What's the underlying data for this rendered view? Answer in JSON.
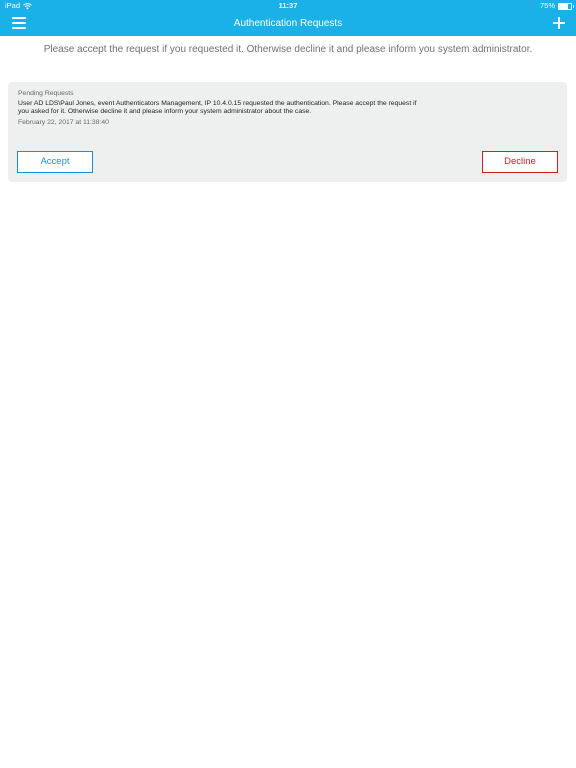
{
  "status_bar": {
    "device": "iPad",
    "time": "11:37",
    "battery": "75%"
  },
  "nav": {
    "title": "Authentication Requests"
  },
  "instructions": "Please accept the request if you requested it. Otherwise decline it and please inform you system administrator.",
  "request_card": {
    "heading": "Pending Requests",
    "message": "User AD LDS\\Paul Jones, event Authenticators Management, IP 10.4.0.15 requested the authentication. Please accept the request if you asked for it. Otherwise decline it and please inform your system administrator about the case.",
    "date": "February 22, 2017 at 11:38:40",
    "accept_label": "Accept",
    "decline_label": "Decline"
  },
  "colors": {
    "header": "#1ab0e8",
    "accept": "#1a8fd6",
    "decline": "#d0212a",
    "card_background": "#eef0f0"
  },
  "icons": {
    "wifi": "wifi-icon",
    "battery": "battery-icon",
    "menu": "hamburger-menu-icon",
    "add": "plus-icon"
  }
}
